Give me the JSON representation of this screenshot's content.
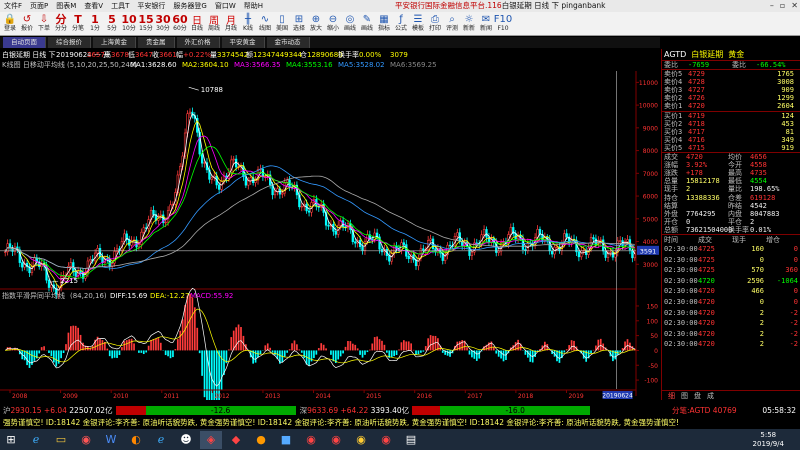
{
  "menubar": {
    "items": [
      "文件F",
      "页面P",
      "图表M",
      "查看V",
      "工具T",
      "平安银行",
      "服务器登G",
      "窗口W",
      "帮助H"
    ],
    "title_prefix": "平安银行国际金融信息平台.116",
    "title_main": "白银延期 日线 下 pinganbank"
  },
  "toolbar": {
    "buttons": [
      {
        "icon": "🔒",
        "label": "登录"
      },
      {
        "icon": "↺",
        "label": "报价"
      },
      {
        "icon": "⇩",
        "label": "下单"
      },
      {
        "icon": "分",
        "label": "分分"
      },
      {
        "icon": "T",
        "label": "分笔"
      },
      {
        "icon": "1",
        "label": "1分"
      },
      {
        "icon": "5",
        "label": "5分"
      },
      {
        "icon": "10",
        "label": "10分"
      },
      {
        "icon": "15",
        "label": "15分"
      },
      {
        "icon": "30",
        "label": "30分"
      },
      {
        "icon": "60",
        "label": "60分"
      },
      {
        "icon": "日",
        "label": "日线"
      },
      {
        "icon": "周",
        "label": "周线"
      },
      {
        "icon": "月",
        "label": "月线"
      },
      {
        "icon": "╫",
        "label": "K线"
      },
      {
        "icon": "∿",
        "label": "线图"
      },
      {
        "icon": "▯",
        "label": "美国"
      },
      {
        "icon": "⊞",
        "label": "选择"
      },
      {
        "icon": "⊕",
        "label": "放大"
      },
      {
        "icon": "⊖",
        "label": "缩小"
      },
      {
        "icon": "◎",
        "label": "画线"
      },
      {
        "icon": "✎",
        "label": "画线"
      },
      {
        "icon": "▦",
        "label": "指标"
      },
      {
        "icon": "ƒ",
        "label": "公式"
      },
      {
        "icon": "☰",
        "label": "模板"
      },
      {
        "icon": "⎙",
        "label": "打印"
      },
      {
        "icon": "⌕",
        "label": "评测"
      },
      {
        "icon": "☼",
        "label": "新新"
      },
      {
        "icon": "✉",
        "label": "新闻"
      },
      {
        "icon": "F10",
        "label": "F10"
      }
    ]
  },
  "tabs": [
    "自动页面",
    "综合报价",
    "上海黄金",
    "贵金属",
    "外汇价格",
    "平安黄金",
    "金市动态"
  ],
  "chart": {
    "header_left": "白银延期 日线 下",
    "header_ohlc": "20190624 一 开",
    "header_open": "3657",
    "header_high_label": "高",
    "header_high": "3678",
    "header_low_label": "低",
    "header_low": "3647",
    "header_close_label": "收",
    "header_close": "3661",
    "header_change_label": "幅",
    "header_change": "+0.22%",
    "header_vol_label": "量",
    "header_vol": "3374542",
    "header_amt_label": "额",
    "header_amt": "12347449344",
    "header_oi_label": "仓",
    "header_oi": "12890680",
    "header_turnover_label": "换手率",
    "header_turnover": "0.00%",
    "header_extra": "3079",
    "ma_title": "K线图 日移动平均线 (5,10,20,25,50,240)",
    "ma_values": [
      {
        "label": "MA1:3628.60",
        "color": "#ffffff"
      },
      {
        "label": "MA2:3604.10",
        "color": "#ffff00"
      },
      {
        "label": "MA3:3566.35",
        "color": "#ff00ff"
      },
      {
        "label": "MA4:3553.16",
        "color": "#00ff00"
      },
      {
        "label": "MA5:3528.02",
        "color": "#3399ff"
      },
      {
        "label": "MA6:3569.25",
        "color": "#888888"
      }
    ],
    "price_labels": [
      "11000",
      "10000",
      "9000",
      "8000",
      "7000",
      "6000",
      "5000",
      "4000",
      "3000"
    ],
    "annot_high": "10788",
    "annot_low": "2215",
    "cursor_price": "3591",
    "macd_title": "指数平滑异同平均线",
    "macd_params": "(84,20,16)",
    "macd_diff": "DIFF:15.69",
    "macd_dea": "DEA:-12.27",
    "macd_macd": "MACD:55.92",
    "macd_labels": [
      "150",
      "100",
      "50",
      "0",
      "-50",
      "-100"
    ],
    "years": [
      "2008",
      "2009",
      "2010",
      "2011",
      "2012",
      "2013",
      "2014",
      "2015",
      "2016",
      "2017",
      "2018",
      "2019"
    ],
    "cursor_date": "20190624"
  },
  "chart_data": {
    "type": "candlestick",
    "title": "白银延期 日线",
    "x": [
      "2008",
      "2009",
      "2010",
      "2011",
      "2012",
      "2013",
      "2014",
      "2015",
      "2016",
      "2017",
      "2018",
      "2019"
    ],
    "ylim": [
      2000,
      11500
    ],
    "series": [
      {
        "name": "close",
        "values": [
          3550,
          2500,
          3600,
          5800,
          7200,
          6200,
          4300,
          3400,
          3900,
          4100,
          3800,
          3661
        ]
      }
    ],
    "annotations": [
      {
        "label": "10788",
        "value": 10788
      },
      {
        "label": "2215",
        "value": 2215
      }
    ],
    "macd": {
      "ylim": [
        -120,
        160
      ],
      "DIFF": 15.69,
      "DEA": -12.27,
      "MACD": 55.92
    }
  },
  "right_panel": {
    "code": "AGTD",
    "name": "白银延期",
    "group": "黄金",
    "rates": {
      "l1": "委比",
      "v1": "-7659",
      "l2": "委比",
      "v2": "-66.54%"
    },
    "sells": [
      {
        "label": "卖价5",
        "price": "4729",
        "vol": "1765"
      },
      {
        "label": "卖价4",
        "price": "4728",
        "vol": "3008"
      },
      {
        "label": "卖价3",
        "price": "4727",
        "vol": "909"
      },
      {
        "label": "卖价2",
        "price": "4726",
        "vol": "1299"
      },
      {
        "label": "卖价1",
        "price": "4720",
        "vol": "2604"
      }
    ],
    "buys": [
      {
        "label": "买价1",
        "price": "4719",
        "vol": "124"
      },
      {
        "label": "买价2",
        "price": "4718",
        "vol": "453"
      },
      {
        "label": "买价3",
        "price": "4717",
        "vol": "81"
      },
      {
        "label": "买价4",
        "price": "4716",
        "vol": "349"
      },
      {
        "label": "买价5",
        "price": "4715",
        "vol": "919"
      }
    ],
    "stats": [
      {
        "l": "成交",
        "v": "4720",
        "l2": "均价",
        "v2": "4656",
        "c1": "",
        "c2": ""
      },
      {
        "l": "涨幅",
        "v": "3.92%",
        "l2": "今开",
        "v2": "4558",
        "c1": "",
        "c2": ""
      },
      {
        "l": "涨跌",
        "v": "+178",
        "l2": "最高",
        "v2": "4735",
        "c1": "",
        "c2": ""
      },
      {
        "l": "总量",
        "v": "15812178",
        "l2": "最低",
        "v2": "4554",
        "c1": "y",
        "c2": "g"
      },
      {
        "l": "现手",
        "v": "2",
        "l2": "量比",
        "v2": "198.65%",
        "c1": "y",
        "c2": "w"
      },
      {
        "l": "持仓",
        "v": "13388336",
        "l2": "仓差",
        "v2": "619128",
        "c1": "y",
        "c2": ""
      },
      {
        "l": "结算",
        "v": "",
        "l2": "昨结",
        "v2": "4542",
        "c1": "w",
        "c2": "w"
      },
      {
        "l": "外盘",
        "v": "7764295",
        "l2": "内盘",
        "v2": "8047883",
        "c1": "w",
        "c2": "w"
      },
      {
        "l": "开仓",
        "v": "0",
        "l2": "平仓",
        "v2": "2",
        "c1": "w",
        "c2": "w"
      },
      {
        "l": "总额",
        "v": "73621504000",
        "l2": "换手率",
        "v2": "0.01%",
        "c1": "w",
        "c2": "w"
      }
    ],
    "tick_head": [
      "时间",
      "成交",
      "现手",
      "增仓"
    ],
    "ticks": [
      {
        "t": "02:30:00",
        "p": "4725",
        "v": "160",
        "n": "0",
        "g": false
      },
      {
        "t": "02:30:00",
        "p": "4725",
        "v": "0",
        "n": "0",
        "g": false
      },
      {
        "t": "02:30:00",
        "p": "4725",
        "v": "570",
        "n": "360",
        "g": false
      },
      {
        "t": "02:30:00",
        "p": "4720",
        "v": "2596",
        "n": "-1064",
        "g": true
      },
      {
        "t": "02:30:00",
        "p": "4720",
        "v": "466",
        "n": "0",
        "g": false
      },
      {
        "t": "02:30:00",
        "p": "4720",
        "v": "0",
        "n": "0",
        "g": false
      },
      {
        "t": "02:30:00",
        "p": "4720",
        "v": "2",
        "n": "-2",
        "g": false
      },
      {
        "t": "02:30:00",
        "p": "4720",
        "v": "2",
        "n": "-2",
        "g": false
      },
      {
        "t": "02:30:00",
        "p": "4720",
        "v": "2",
        "n": "-2",
        "g": false
      },
      {
        "t": "02:30:00",
        "p": "4720",
        "v": "2",
        "n": "-2",
        "g": false
      }
    ],
    "bottom_tabs": [
      "细",
      "图",
      "盘",
      "成"
    ]
  },
  "status": {
    "sh_label": "沪",
    "sh_price": "2930.15",
    "sh_change": "+6.04",
    "sh_amt": "22507.02亿",
    "sh_bar": "-12.6",
    "sz_label": "深",
    "sz_price": "9633.69",
    "sz_change": "+64.22",
    "sz_amt": "3393.40亿",
    "sz_bar": "-16.0",
    "fenbi": "分笔:AGTD 40769",
    "clock": "05:58:32"
  },
  "ticker": "强势谨慎空!  ID:18142    金银评论:李齐善: 原油听话貌势跌, 黄金强势谨慎空!  ID:18142    金银评论:李齐善: 原油听话貌势跌, 黄金强势谨慎空!  ID:18142    金银评论:李齐善: 原油听话貌势跌, 黄金强势谨慎空!",
  "taskbar": {
    "time": "5:58",
    "date": "2019/9/4"
  }
}
